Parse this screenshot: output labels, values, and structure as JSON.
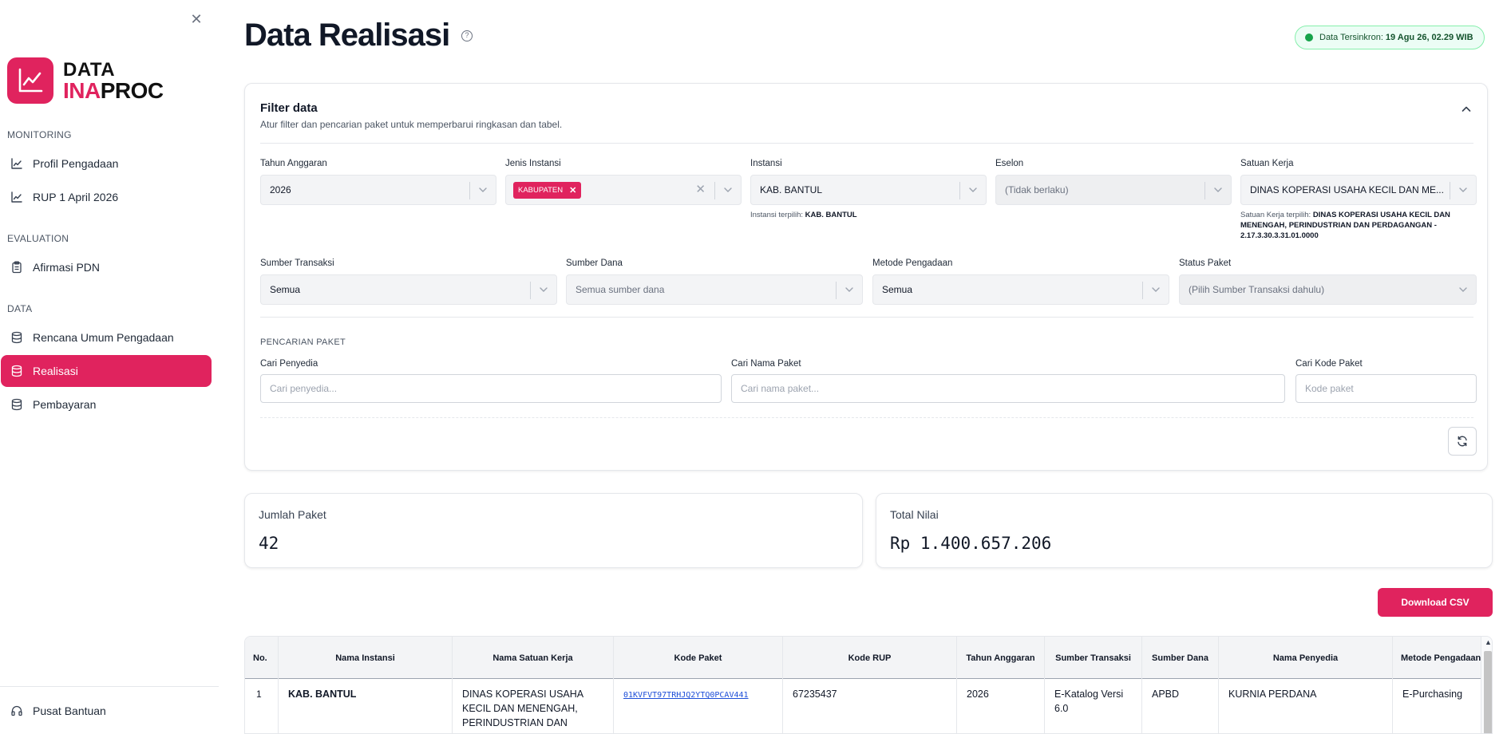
{
  "sidebar": {
    "logo": {
      "line1": "DATA",
      "line2a": "INA",
      "line2b": "PROC"
    },
    "sections": {
      "monitoring": "MONITORING",
      "evaluation": "EVALUATION",
      "data": "DATA"
    },
    "items": {
      "profil": "Profil Pengadaan",
      "rup": "RUP 1 April 2026",
      "afirmasi": "Afirmasi PDN",
      "rencana": "Rencana Umum Pengadaan",
      "realisasi": "Realisasi",
      "pembayaran": "Pembayaran"
    },
    "help": "Pusat Bantuan",
    "active_color": "#e0235e"
  },
  "header": {
    "title": "Data Realisasi",
    "sync_label": "Data Tersinkron:",
    "sync_value": "19 Agu 26, 02.29 WIB"
  },
  "filter": {
    "title": "Filter data",
    "subtitle": "Atur filter dan pencarian paket untuk memperbarui ringkasan dan tabel.",
    "tahun": {
      "label": "Tahun Anggaran",
      "value": "2026"
    },
    "jenis": {
      "label": "Jenis Instansi",
      "tag": "KABUPATEN"
    },
    "instansi": {
      "label": "Instansi",
      "value": "KAB. BANTUL",
      "helper_label": "Instansi terpilih:",
      "helper_value": "KAB. BANTUL"
    },
    "eselon": {
      "label": "Eselon",
      "value": "(Tidak berlaku)"
    },
    "satker": {
      "label": "Satuan Kerja",
      "value": "DINAS KOPERASI USAHA KECIL DAN ME...",
      "helper_label": "Satuan Kerja terpilih:",
      "helper_value": "DINAS KOPERASI USAHA KECIL DAN MENENGAH, PERINDUSTRIAN DAN PERDAGANGAN - 2.17.3.30.3.31.01.0000"
    },
    "sumber_transaksi": {
      "label": "Sumber Transaksi",
      "value": "Semua"
    },
    "sumber_dana": {
      "label": "Sumber Dana",
      "value": "Semua sumber dana"
    },
    "metode": {
      "label": "Metode Pengadaan",
      "value": "Semua"
    },
    "status": {
      "label": "Status Paket",
      "value": "(Pilih Sumber Transaksi dahulu)"
    },
    "search_caption": "PENCARIAN PAKET",
    "penyedia": {
      "label": "Cari Penyedia",
      "placeholder": "Cari penyedia..."
    },
    "nama_paket": {
      "label": "Cari Nama Paket",
      "placeholder": "Cari nama paket..."
    },
    "kode_paket": {
      "label": "Cari Kode Paket",
      "placeholder": "Kode paket"
    }
  },
  "stats": {
    "jumlah": {
      "label": "Jumlah Paket",
      "value": "42"
    },
    "total": {
      "label": "Total Nilai",
      "value": "Rp 1.400.657.206"
    }
  },
  "download_label": "Download CSV",
  "table": {
    "columns": [
      "No.",
      "Nama Instansi",
      "Nama Satuan Kerja",
      "Kode Paket",
      "Kode RUP",
      "Tahun Anggaran",
      "Sumber Transaksi",
      "Sumber Dana",
      "Nama Penyedia",
      "Metode Pengadaan"
    ],
    "rows": [
      {
        "no": "1",
        "instansi": "KAB. BANTUL",
        "satker": "DINAS KOPERASI USAHA KECIL DAN MENENGAH, PERINDUSTRIAN DAN PERDAGANGAN -",
        "kode_paket": "01KVFVT97TRHJQ2YTQ0PCAV441",
        "kode_rup": "67235437",
        "tahun": "2026",
        "sumber_transaksi": "E-Katalog Versi 6.0",
        "sumber_dana": "APBD",
        "penyedia": "KURNIA PERDANA",
        "metode": "E-Purchasing"
      }
    ]
  }
}
